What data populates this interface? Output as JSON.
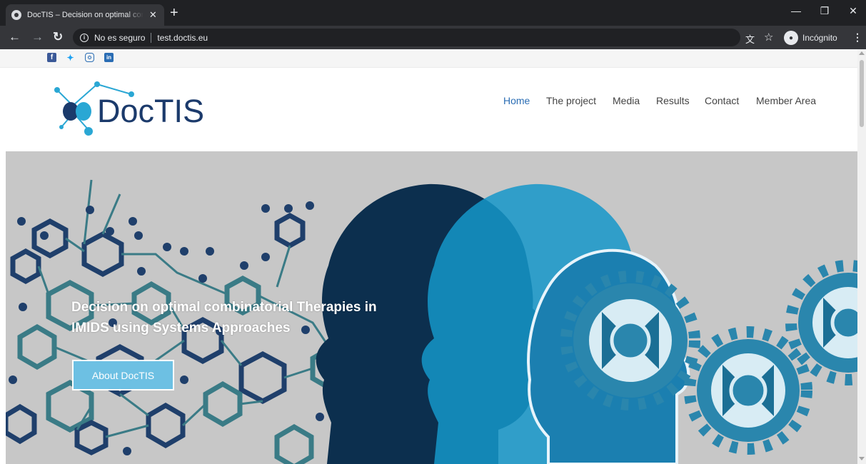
{
  "browser": {
    "tab_title": "DocTIS – Decision on optimal con",
    "tab_close": "✕",
    "new_tab": "+",
    "security_label": "No es seguro",
    "url": "test.doctis.eu",
    "profile_label": "Incógnito",
    "icons": [
      "back-icon",
      "forward-icon",
      "reload-icon",
      "info-icon",
      "translate-icon",
      "star-icon",
      "incognito-icon",
      "menu-icon",
      "minimize-icon",
      "restore-icon",
      "close-icon"
    ]
  },
  "social": {
    "icons": [
      "facebook-icon",
      "twitter-icon",
      "instagram-icon",
      "linkedin-icon"
    ],
    "colors": {
      "facebook": "#3b5998",
      "twitter": "#1da1f2",
      "instagram": "#2a6db4",
      "linkedin": "#2a6db4"
    }
  },
  "logo": {
    "text": "DocTIS"
  },
  "nav": {
    "items": [
      {
        "label": "Home",
        "active": true
      },
      {
        "label": "The project"
      },
      {
        "label": "Media"
      },
      {
        "label": "Results"
      },
      {
        "label": "Contact"
      },
      {
        "label": "Member Area"
      }
    ]
  },
  "hero": {
    "title": "Decision on optimal combinatorial Therapies in IMIDS using Systems Approaches",
    "button_label": "About DocTIS"
  },
  "colors": {
    "brand_dark": "#1b3a6b",
    "brand_light": "#2aa7d4",
    "nav_active": "#2a6db4",
    "hero_bg": "#c7c7c7",
    "button_bg": "#6dc0e3"
  }
}
